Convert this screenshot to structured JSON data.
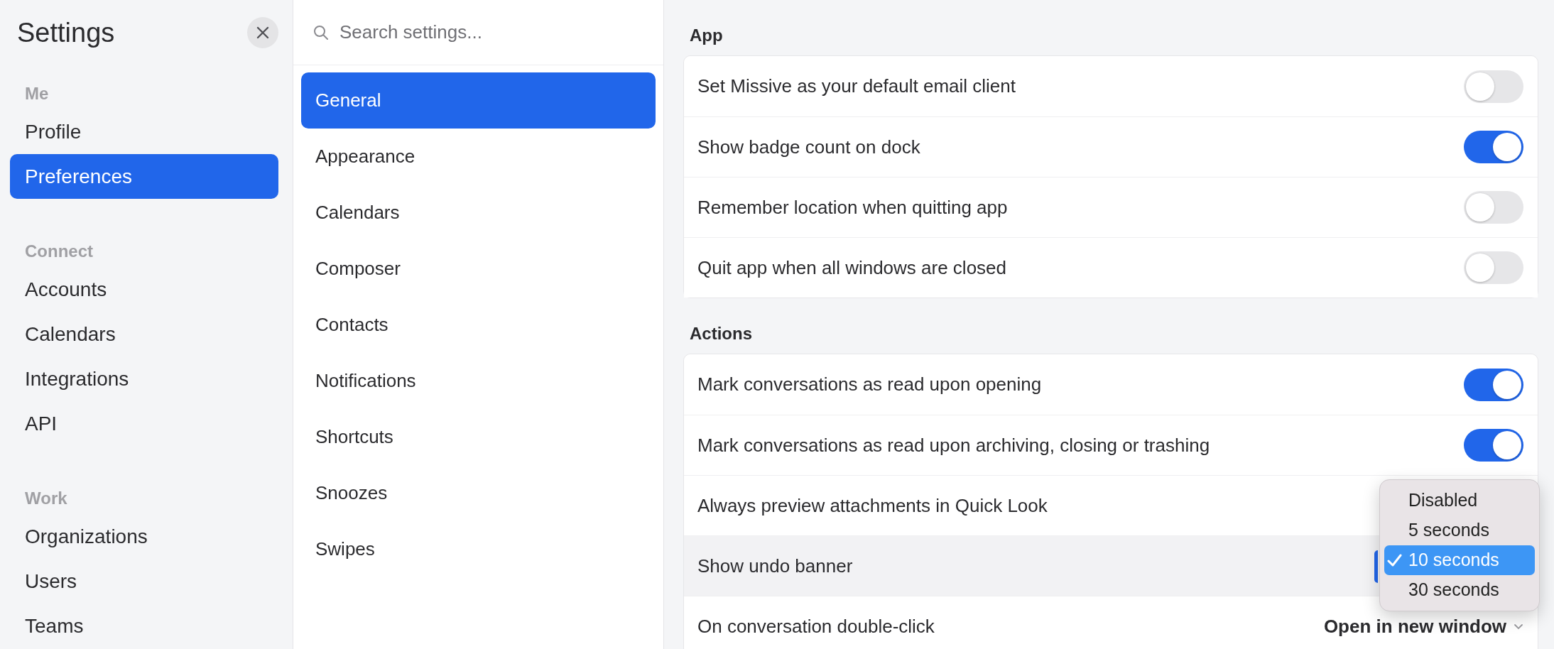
{
  "sidebar": {
    "title": "Settings",
    "sections": [
      {
        "heading": "Me",
        "items": [
          {
            "label": "Profile",
            "selected": false
          },
          {
            "label": "Preferences",
            "selected": true
          }
        ]
      },
      {
        "heading": "Connect",
        "items": [
          {
            "label": "Accounts",
            "selected": false
          },
          {
            "label": "Calendars",
            "selected": false
          },
          {
            "label": "Integrations",
            "selected": false
          },
          {
            "label": "API",
            "selected": false
          }
        ]
      },
      {
        "heading": "Work",
        "items": [
          {
            "label": "Organizations",
            "selected": false
          },
          {
            "label": "Users",
            "selected": false
          },
          {
            "label": "Teams",
            "selected": false
          }
        ]
      }
    ]
  },
  "categories": {
    "search": {
      "placeholder": "Search settings..."
    },
    "items": [
      {
        "label": "General",
        "selected": true
      },
      {
        "label": "Appearance",
        "selected": false
      },
      {
        "label": "Calendars",
        "selected": false
      },
      {
        "label": "Composer",
        "selected": false
      },
      {
        "label": "Contacts",
        "selected": false
      },
      {
        "label": "Notifications",
        "selected": false
      },
      {
        "label": "Shortcuts",
        "selected": false
      },
      {
        "label": "Snoozes",
        "selected": false
      },
      {
        "label": "Swipes",
        "selected": false
      }
    ]
  },
  "groups": [
    {
      "heading": "App",
      "rows": [
        {
          "label": "Set Missive as your default email client",
          "kind": "toggle",
          "on": false,
          "hovered": false
        },
        {
          "label": "Show badge count on dock",
          "kind": "toggle",
          "on": true,
          "hovered": false
        },
        {
          "label": "Remember location when quitting app",
          "kind": "toggle",
          "on": false,
          "hovered": false
        },
        {
          "label": "Quit app when all windows are closed",
          "kind": "toggle",
          "on": false,
          "hovered": false
        }
      ]
    },
    {
      "heading": "Actions",
      "rows": [
        {
          "label": "Mark conversations as read upon opening",
          "kind": "toggle",
          "on": true,
          "hovered": false
        },
        {
          "label": "Mark conversations as read upon archiving, closing or trashing",
          "kind": "toggle",
          "on": true,
          "hovered": false
        },
        {
          "label": "Always preview attachments in Quick Look",
          "kind": "blank",
          "hovered": false
        },
        {
          "label": "Show undo banner",
          "kind": "select",
          "hovered": true,
          "menu": [
            {
              "label": "Disabled",
              "selected": false
            },
            {
              "label": "5 seconds",
              "selected": false
            },
            {
              "label": "10 seconds",
              "selected": true
            },
            {
              "label": "30 seconds",
              "selected": false
            }
          ]
        },
        {
          "label": "On conversation double-click",
          "kind": "dropdown",
          "value": "Open in new window",
          "hovered": false
        }
      ]
    }
  ]
}
